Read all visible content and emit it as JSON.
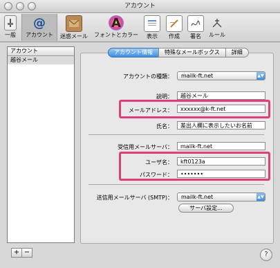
{
  "window": {
    "title": "アカウント"
  },
  "toolbar": {
    "items": [
      {
        "label": "一般",
        "icon": "general-icon"
      },
      {
        "label": "アカウント",
        "icon": "at-icon"
      },
      {
        "label": "迷惑メール",
        "icon": "junk-mail-icon"
      },
      {
        "label": "フォントとカラー",
        "icon": "fonts-colors-icon"
      },
      {
        "label": "表示",
        "icon": "viewing-icon"
      },
      {
        "label": "作成",
        "icon": "composing-icon"
      },
      {
        "label": "署名",
        "icon": "signatures-icon"
      },
      {
        "label": "ルール",
        "icon": "rules-icon"
      }
    ],
    "selected": "アカウント"
  },
  "sidebar": {
    "header": "アカウント",
    "items": [
      {
        "label": "越谷メール"
      }
    ],
    "add_label": "+",
    "remove_label": "−"
  },
  "tabs": [
    {
      "label": "アカウント情報",
      "active": true
    },
    {
      "label": "特殊なメールボックス",
      "active": false
    },
    {
      "label": "詳細",
      "active": false
    }
  ],
  "form": {
    "account_type": {
      "label": "アカウントの種類：",
      "value": "mailk-ft.net"
    },
    "description": {
      "label": "説明：",
      "value": "越谷メール"
    },
    "email": {
      "label": "メールアドレス：",
      "value": "xxxxxx@k-ft.net"
    },
    "full_name": {
      "label": "氏名：",
      "value": "差出人欄に表示したいお名前"
    },
    "incoming_server": {
      "label": "受信用メールサーバ：",
      "value": "mailk-ft.net"
    },
    "username": {
      "label": "ユーザ名：",
      "value": "kft0123a"
    },
    "password": {
      "label": "パスワード：",
      "value": "•••••••"
    },
    "smtp": {
      "label": "送信用メールサーバ (SMTP)：",
      "value": "mailk-ft.net"
    },
    "server_settings_button": "サーバ設定..."
  },
  "help": {
    "label": "?"
  },
  "colors": {
    "highlight": "#e0407a",
    "accent": "#3f8fe0"
  }
}
